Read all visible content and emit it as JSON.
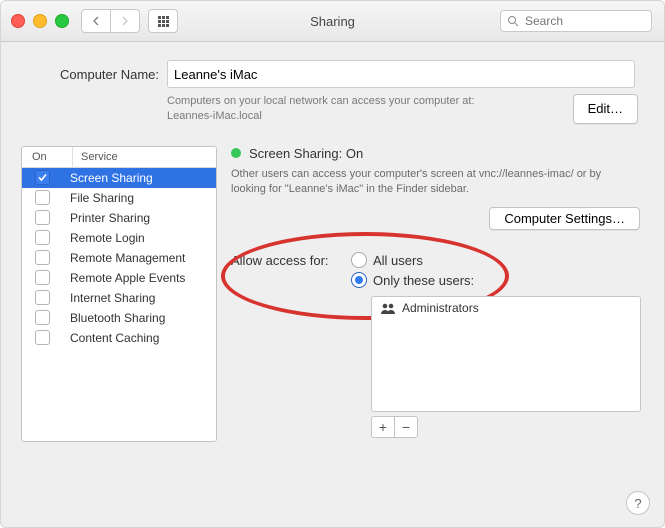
{
  "window": {
    "title": "Sharing"
  },
  "search": {
    "placeholder": "Search"
  },
  "computer_name": {
    "label": "Computer Name:",
    "value": "Leanne's iMac",
    "sub_line1": "Computers on your local network can access your computer at:",
    "sub_line2": "Leannes-iMac.local",
    "edit_label": "Edit…"
  },
  "services": {
    "header_on": "On",
    "header_service": "Service",
    "items": [
      {
        "label": "Screen Sharing",
        "on": true,
        "selected": true
      },
      {
        "label": "File Sharing",
        "on": false,
        "selected": false
      },
      {
        "label": "Printer Sharing",
        "on": false,
        "selected": false
      },
      {
        "label": "Remote Login",
        "on": false,
        "selected": false
      },
      {
        "label": "Remote Management",
        "on": false,
        "selected": false
      },
      {
        "label": "Remote Apple Events",
        "on": false,
        "selected": false
      },
      {
        "label": "Internet Sharing",
        "on": false,
        "selected": false
      },
      {
        "label": "Bluetooth Sharing",
        "on": false,
        "selected": false
      },
      {
        "label": "Content Caching",
        "on": false,
        "selected": false
      }
    ]
  },
  "status": {
    "title": "Screen Sharing: On",
    "desc": "Other users can access your computer's screen at vnc://leannes-imac/ or by looking for \"Leanne's iMac\" in the Finder sidebar.",
    "computer_settings_label": "Computer Settings…"
  },
  "access": {
    "label": "Allow access for:",
    "option_all": "All users",
    "option_only": "Only these users:",
    "selected": "only",
    "users": [
      {
        "label": "Administrators"
      }
    ],
    "add_label": "+",
    "remove_label": "−"
  },
  "help_label": "?"
}
